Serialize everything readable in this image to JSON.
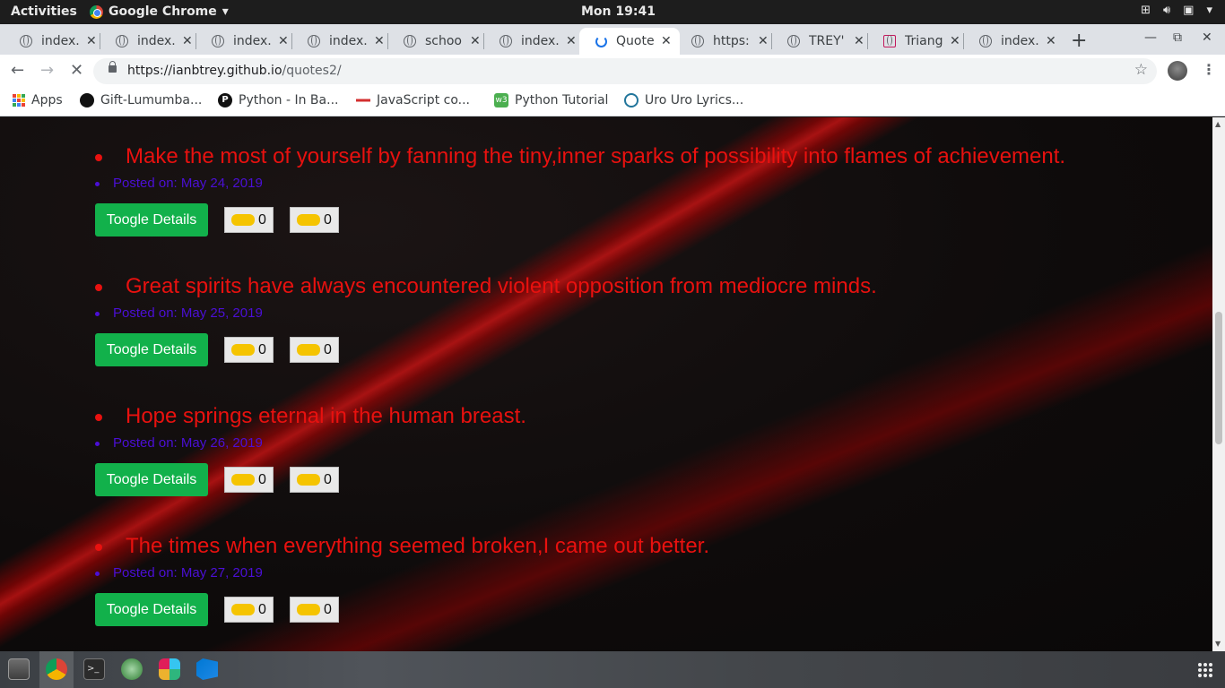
{
  "topbar": {
    "activities": "Activities",
    "app_name": "Google Chrome",
    "clock": "Mon 19:41"
  },
  "tabs": [
    {
      "label": "index.",
      "active": false
    },
    {
      "label": "index.",
      "active": false
    },
    {
      "label": "index.",
      "active": false
    },
    {
      "label": "index.",
      "active": false
    },
    {
      "label": "schoo",
      "active": false
    },
    {
      "label": "index.",
      "active": false
    },
    {
      "label": "Quote",
      "active": true
    },
    {
      "label": "https:",
      "active": false
    },
    {
      "label": "TREY'",
      "active": false
    },
    {
      "label": "Triang",
      "active": false
    },
    {
      "label": "index.",
      "active": false
    }
  ],
  "toolbar": {
    "url_host": "https://ianbtrey.github.io",
    "url_path": "/quotes2/"
  },
  "bookmarks": [
    {
      "label": "Apps",
      "icon": "apps-grid-icon"
    },
    {
      "label": "Gift-Lumumba...",
      "icon": "github-icon"
    },
    {
      "label": "Python - In Ba...",
      "icon": "python-p-icon"
    },
    {
      "label": "JavaScript co...",
      "icon": "javascript-site-icon"
    },
    {
      "label": "Python Tutorial",
      "icon": "w3schools-icon"
    },
    {
      "label": "Uro Uro Lyrics...",
      "icon": "wordpress-icon"
    }
  ],
  "quotes": [
    {
      "text": "Make the most of yourself by fanning the tiny,inner sparks of possibility into flames of achievement.",
      "date": "Posted on: May 24, 2019",
      "toggle": "Toogle Details",
      "upvotes": "0",
      "downvotes": "0"
    },
    {
      "text": "Great spirits have always encountered violent opposition from mediocre minds.",
      "date": "Posted on: May 25, 2019",
      "toggle": "Toogle Details",
      "upvotes": "0",
      "downvotes": "0"
    },
    {
      "text": "Hope springs eternal in the human breast.",
      "date": "Posted on: May 26, 2019",
      "toggle": "Toogle Details",
      "upvotes": "0",
      "downvotes": "0"
    },
    {
      "text": "The times when everything seemed broken,I came out better.",
      "date": "Posted on: May 27, 2019",
      "toggle": "Toogle Details",
      "upvotes": "0",
      "downvotes": "0"
    }
  ],
  "colors": {
    "quote_text": "#e8110f",
    "date_text": "#4b0fd6",
    "toggle_button": "#12b14b",
    "vote_pill": "#f5c400"
  }
}
